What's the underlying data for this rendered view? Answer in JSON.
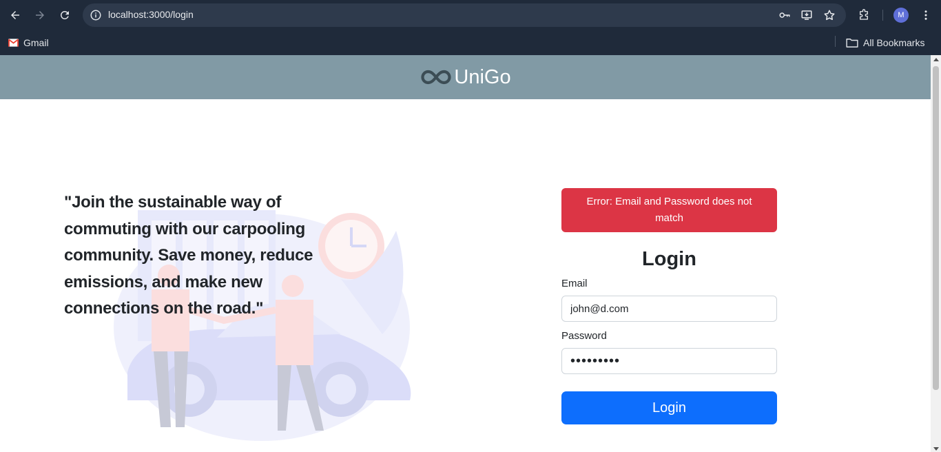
{
  "browser": {
    "url": "localhost:3000/login",
    "profile_initial": "M",
    "bookmarks": [
      {
        "label": "Gmail"
      },
      {
        "label": "All Bookmarks"
      }
    ]
  },
  "site": {
    "brand": "UniGo",
    "header_color": "#819aa5"
  },
  "hero": {
    "tagline": "\"Join the sustainable way of commuting with our carpooling community. Save money, reduce emissions, and make new connections on the road.\""
  },
  "login": {
    "error_message": "Error: Email and Password does not match",
    "title": "Login",
    "email_label": "Email",
    "email_value": "john@d.com",
    "password_label": "Password",
    "password_value": "•••••••••",
    "submit_label": "Login",
    "error_color": "#dc3545",
    "button_color": "#0d6efd"
  }
}
